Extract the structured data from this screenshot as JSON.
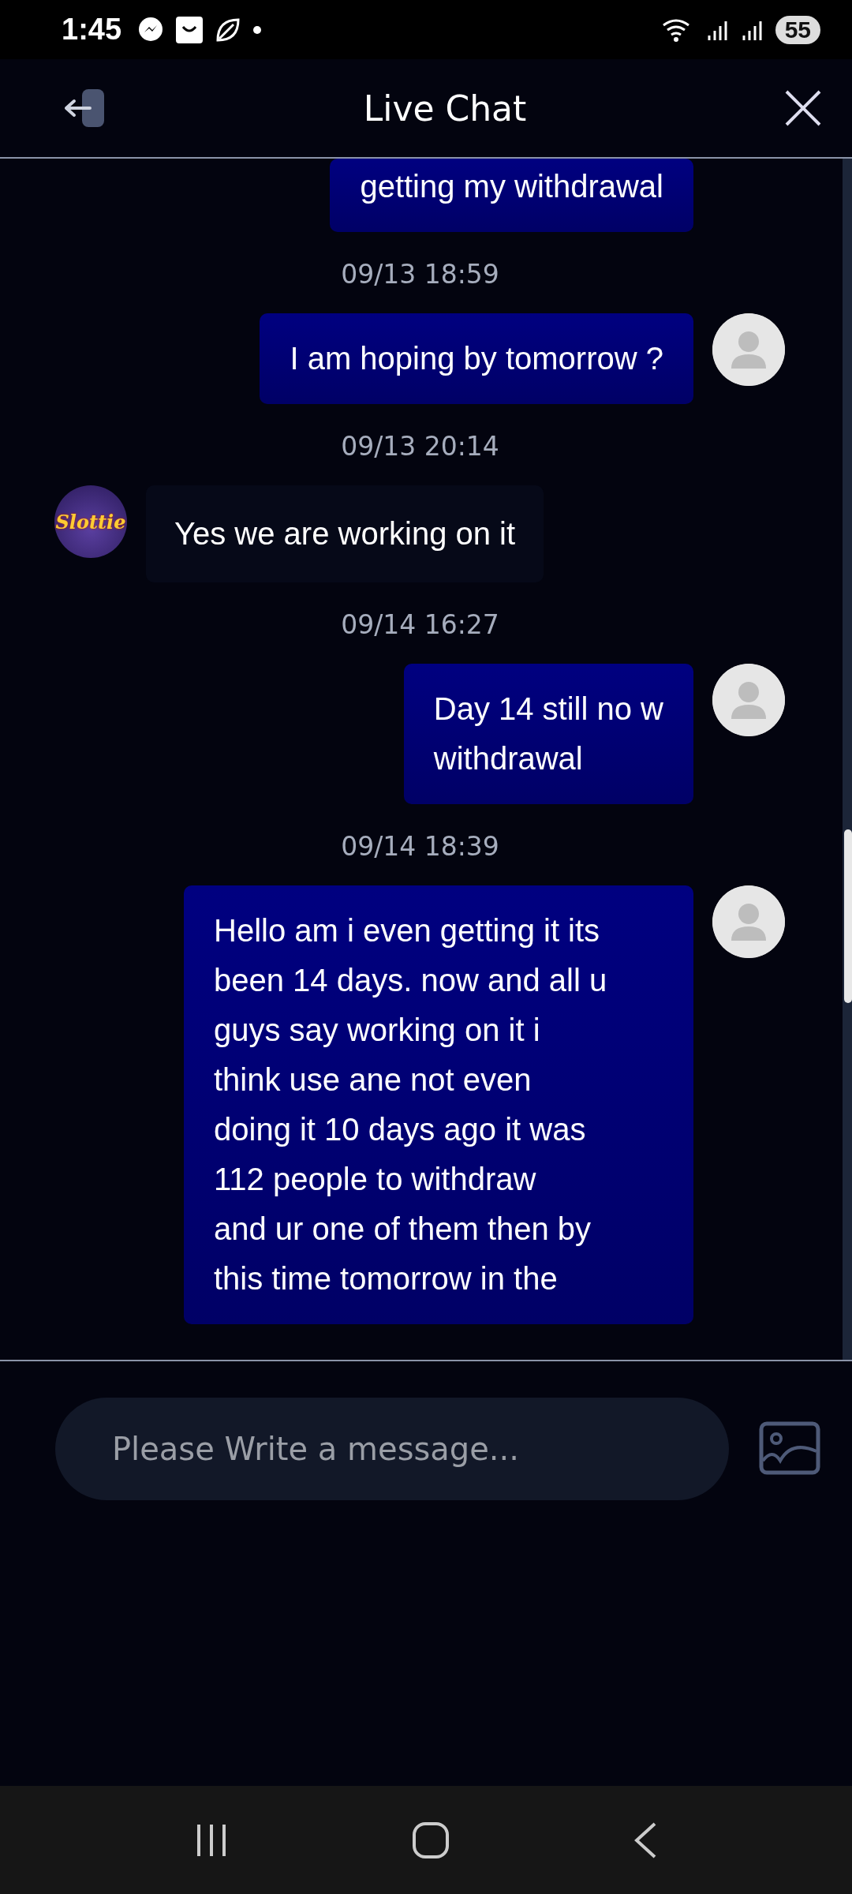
{
  "status_bar": {
    "time": "1:45",
    "battery": "55"
  },
  "header": {
    "title": "Live Chat"
  },
  "messages": [
    {
      "kind": "sent",
      "text": "getting my withdrawal",
      "avatar": false
    },
    {
      "kind": "time",
      "text": "09/13 18:59"
    },
    {
      "kind": "sent",
      "text": "I am hoping by tomorrow ?",
      "avatar": true
    },
    {
      "kind": "time",
      "text": "09/13 20:14"
    },
    {
      "kind": "received",
      "text": "Yes we are working on it",
      "avatar": true,
      "avatar_text": "Slottie"
    },
    {
      "kind": "time",
      "text": "09/14 16:27"
    },
    {
      "kind": "sent",
      "text": "Day 14 still no w\nwithdrawal",
      "avatar": true
    },
    {
      "kind": "time",
      "text": "09/14 18:39"
    },
    {
      "kind": "sent",
      "text": "Hello am i even getting it its\nbeen 14 days. now and all u\nguys say working on it i\nthink use ane not even\ndoing it 10 days ago it was\n112 people to withdraw\nand ur one of them then by\nthis time tomorrow in the",
      "avatar": true
    }
  ],
  "composer": {
    "placeholder": "Please Write a message..."
  }
}
